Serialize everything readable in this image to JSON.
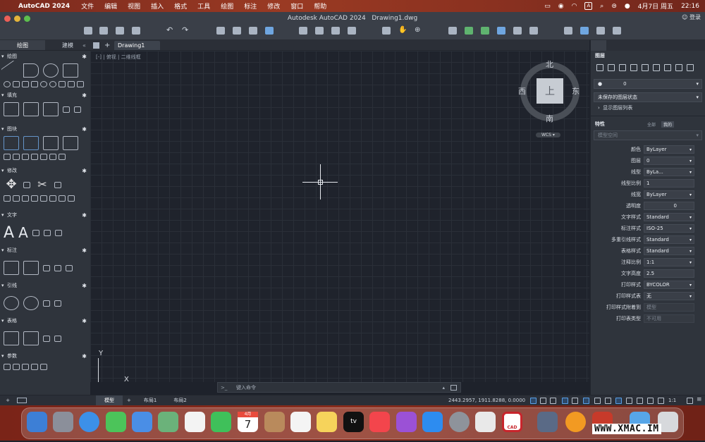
{
  "menubar": {
    "app": "AutoCAD 2024",
    "items": [
      "文件",
      "编辑",
      "视图",
      "插入",
      "格式",
      "工具",
      "绘图",
      "标注",
      "修改",
      "窗口",
      "帮助"
    ],
    "date": "4月7日 周五",
    "time": "22:16",
    "input_indicator": "A",
    "user": "登录"
  },
  "window": {
    "title": "Autodesk AutoCAD 2024",
    "file": "Drawing1.dwg"
  },
  "left_tabs": [
    "绘图",
    "建模"
  ],
  "doc_tab": "Drawing1",
  "viewport_label": "[-] 俯视 | 二维线框",
  "viewport_parts": {
    "minus": "-",
    "view": "俯视",
    "style": "二维线框"
  },
  "tool_sections": [
    "绘图",
    "填充",
    "图块",
    "修改",
    "文字",
    "标注",
    "引线",
    "表格",
    "参数"
  ],
  "viewcube": {
    "top": "上",
    "north": "北",
    "south": "南",
    "east": "东",
    "west": "西",
    "wcs": "WCS"
  },
  "ucs": {
    "x": "X",
    "y": "Y"
  },
  "command": {
    "placeholder": "键入命令",
    "prompt": ">_"
  },
  "status": {
    "tabs": [
      "模型",
      "布局1",
      "布局2"
    ],
    "coords": "2443.2957, 1911.8288, 0.0000",
    "scale": "1:1"
  },
  "layers": {
    "title": "图层",
    "current": "0",
    "state": "未保存的图层状态",
    "show_list": "显示图层列表"
  },
  "properties": {
    "title": "特性",
    "toggle": [
      "全部",
      "我的"
    ],
    "space": "模型空间",
    "rows": [
      {
        "k": "颜色",
        "v": "ByLayer"
      },
      {
        "k": "图层",
        "v": "0"
      },
      {
        "k": "线型",
        "v": "ByLa..."
      },
      {
        "k": "线型比例",
        "v": "1"
      },
      {
        "k": "线宽",
        "v": "ByLayer"
      },
      {
        "k": "透明度",
        "v": "0"
      },
      {
        "k": "文字样式",
        "v": "Standard"
      },
      {
        "k": "标注样式",
        "v": "ISO-25"
      },
      {
        "k": "多重引线样式",
        "v": "Standard"
      },
      {
        "k": "表格样式",
        "v": "Standard"
      },
      {
        "k": "注释比例",
        "v": "1:1"
      },
      {
        "k": "文字高度",
        "v": "2.5"
      },
      {
        "k": "打印样式",
        "v": "BYCOLOR"
      },
      {
        "k": "打印样式表",
        "v": "无"
      },
      {
        "k": "打印样式附着到",
        "v": "模型"
      },
      {
        "k": "打印表类型",
        "v": "不可用"
      }
    ]
  },
  "dock": {
    "calendar_month": "4月",
    "calendar_day": "7",
    "tv": "tv",
    "cad": "CAD"
  },
  "watermark": "WWW.XMAC.IM",
  "colors": {
    "accent": "#6fa6e0",
    "canvas": "#1f232c",
    "panel": "#2f343c",
    "menubar": "#8a3120"
  }
}
